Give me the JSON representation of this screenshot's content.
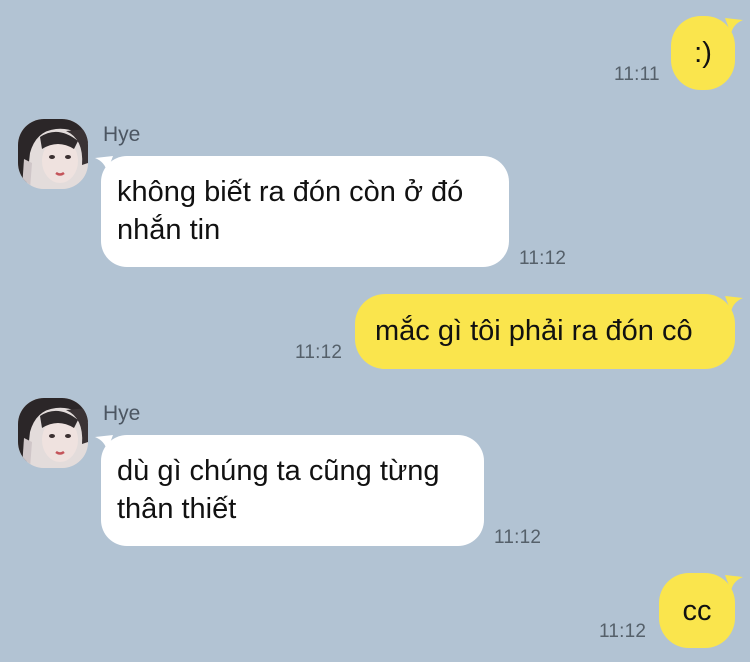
{
  "contact": {
    "name": "Hye",
    "avatar_icon": "profile-photo"
  },
  "colors": {
    "background": "#b2c3d3",
    "outgoing_bubble": "#fae54d",
    "incoming_bubble": "#ffffff"
  },
  "messages": [
    {
      "direction": "outgoing",
      "text": ":)",
      "time": "11:11"
    },
    {
      "direction": "incoming",
      "sender": "Hye",
      "line1": "không biết ra đón còn ở đó",
      "line2": "nhắn tin",
      "time": "11:12"
    },
    {
      "direction": "outgoing",
      "text": "mắc gì tôi phải ra đón cô",
      "time": "11:12"
    },
    {
      "direction": "incoming",
      "sender": "Hye",
      "line1": "dù gì chúng ta cũng từng",
      "line2": "thân thiết",
      "time": "11:12"
    },
    {
      "direction": "outgoing",
      "text": "cc",
      "time": "11:12"
    }
  ]
}
